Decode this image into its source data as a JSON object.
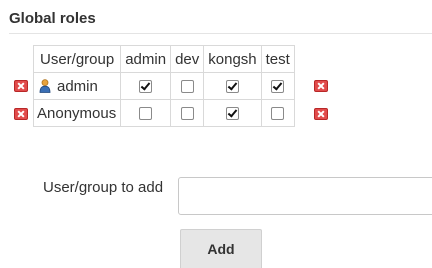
{
  "section": {
    "title": "Global roles"
  },
  "roles_table": {
    "header": {
      "user_group": "User/group",
      "roles": [
        "admin",
        "dev",
        "kongsh",
        "test"
      ]
    },
    "rows": [
      {
        "name": "admin",
        "icon": "user-icon",
        "permissions": [
          true,
          false,
          true,
          true
        ]
      },
      {
        "name": "Anonymous",
        "icon": null,
        "permissions": [
          false,
          false,
          true,
          false
        ]
      }
    ]
  },
  "add_user": {
    "label": "User/group to add",
    "value": "",
    "placeholder": "",
    "button_label": "Add"
  },
  "colors": {
    "delete_icon": "#e14b4b",
    "border": "#d9d9d9",
    "button_bg": "#e6e6e6"
  }
}
